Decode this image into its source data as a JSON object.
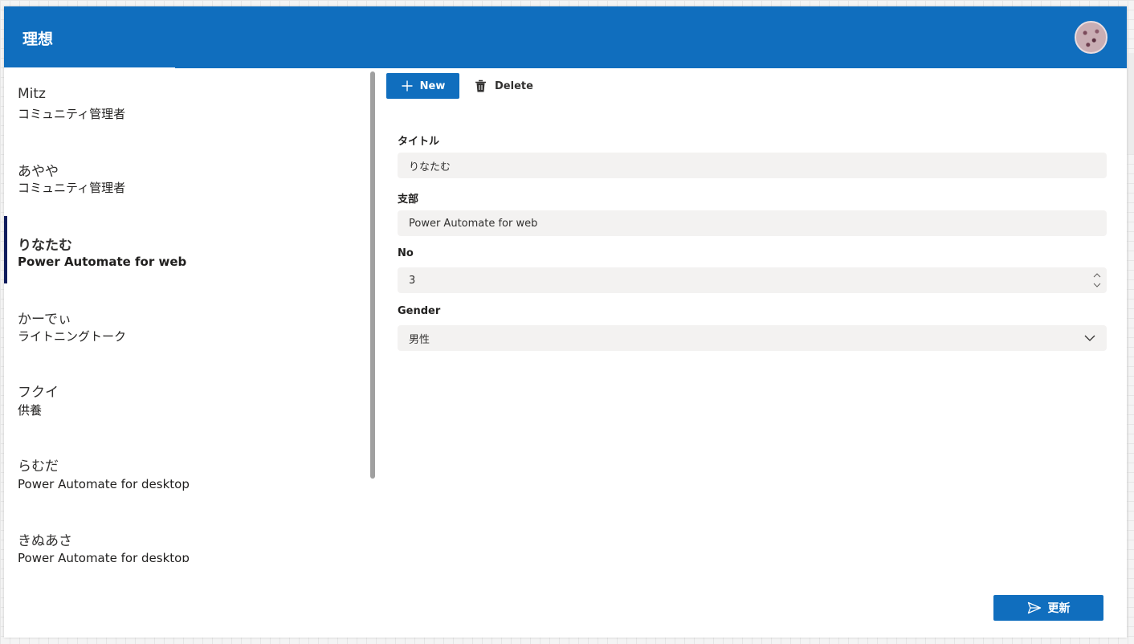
{
  "header": {
    "title": "理想"
  },
  "gallery": {
    "items": [
      {
        "name": "Mitz",
        "sub": "コミュニティ管理者",
        "selected": false
      },
      {
        "name": "あやや",
        "sub": "コミュニティ管理者",
        "selected": false
      },
      {
        "name": "りなたむ",
        "sub": "Power Automate for web",
        "selected": true
      },
      {
        "name": "かーでぃ",
        "sub": "ライトニングトーク",
        "selected": false
      },
      {
        "name": "フクイ",
        "sub": "供養",
        "selected": false
      },
      {
        "name": "らむだ",
        "sub": "Power Automate for desktop",
        "selected": false
      },
      {
        "name": "きぬあさ",
        "sub": "Power Automate for desktop",
        "selected": false
      }
    ]
  },
  "toolbar": {
    "new_label": "New",
    "delete_label": "Delete"
  },
  "form": {
    "title_label": "タイトル",
    "title_value": "りなたむ",
    "branch_label": "支部",
    "branch_value": "Power Automate for web",
    "no_label": "No",
    "no_value": "3",
    "gender_label": "Gender",
    "gender_value": "男性"
  },
  "footer": {
    "update_label": "更新"
  },
  "colors": {
    "accent": "#106ebe",
    "selection_bar": "#0f1c5c",
    "field_bg": "#f3f2f1"
  },
  "icons": {
    "new": "plus-icon",
    "delete": "trash-icon",
    "update": "send-icon",
    "dropdown": "chevron-down-icon",
    "stepper": "spinner-arrows-icon"
  }
}
